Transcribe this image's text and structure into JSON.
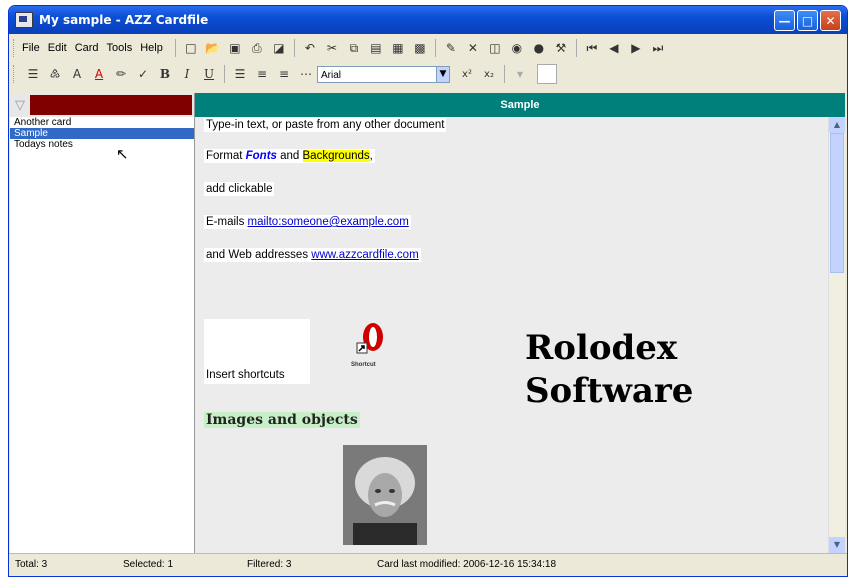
{
  "window": {
    "title": "My sample - AZZ Cardfile"
  },
  "menu": [
    {
      "label": "File"
    },
    {
      "label": "Edit"
    },
    {
      "label": "Card"
    },
    {
      "label": "Tools"
    },
    {
      "label": "Help"
    }
  ],
  "format_toolbar": {
    "font_name": "Arial",
    "bold": "B",
    "italic": "I",
    "underline": "U",
    "superscript": "x²",
    "subscript": "x₂"
  },
  "filter": {
    "color": "#800000"
  },
  "cards": [
    {
      "label": "Another card",
      "selected": false
    },
    {
      "label": "Sample",
      "selected": true
    },
    {
      "label": "Todays notes",
      "selected": false
    }
  ],
  "card": {
    "title": "Sample",
    "header_color": "#00807a",
    "line1": "Type-in text, or paste from any other document",
    "format_prefix": "Format ",
    "fonts_word": "Fonts",
    "format_and": " and ",
    "backgrounds_word": "Backgrounds",
    "format_suffix": ",",
    "clickable": "add clickable",
    "emails_label": "E-mails ",
    "email_link": "mailto:someone@example.com",
    "web_label": "and Web addresses  ",
    "web_link": "www.azzcardfile.com",
    "shortcuts_label": "Insert shortcuts",
    "shortcut_caption": "Shortcut",
    "images_title": "Images and objects"
  },
  "watermark": {
    "line1": "Rolodex",
    "line2": "Software"
  },
  "status": {
    "total": "Total: 3",
    "selected": "Selected: 1",
    "filtered": "Filtered: 3",
    "modified": "Card last modified: 2006-12-16  15:34:18"
  }
}
